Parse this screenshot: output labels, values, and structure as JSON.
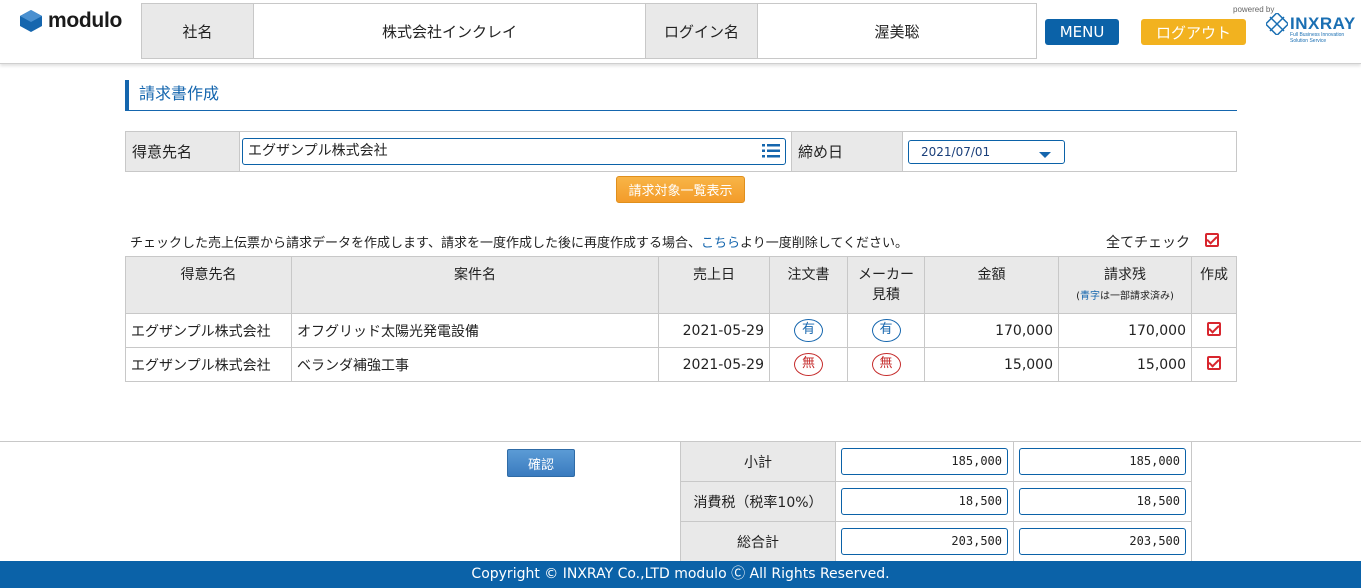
{
  "header": {
    "logo_text": "modulo",
    "company_label": "社名",
    "company_value": "株式会社インクレイ",
    "login_label": "ログイン名",
    "login_value": "渥美聡",
    "menu_label": "MENU",
    "logout_label": "ログアウト",
    "powered_by": "powered by",
    "brand_name": "INXRAY",
    "brand_tagline": "Full Business Innovation Solution Service",
    "menu_color": "#0b62a8",
    "logout_color": "#f2b21f"
  },
  "page": {
    "title": "請求書作成"
  },
  "search": {
    "customer_label": "得意先名",
    "customer_value": "エグザンプル株式会社",
    "closing_label": "締め日",
    "closing_value": "2021/07/01",
    "list_button": "請求対象一覧表示"
  },
  "note": {
    "text_before": "チェックした売上伝票から請求データを作成します、請求を一度作成した後に再度作成する場合、",
    "link": "こちら",
    "text_after": "より一度削除してください。",
    "check_all": "全てチェック"
  },
  "table": {
    "headers": {
      "customer": "得意先名",
      "project": "案件名",
      "sales_date": "売上日",
      "order": "注文書",
      "maker": "メーカー",
      "maker2": "見積",
      "amount": "金額",
      "remaining": "請求残",
      "remaining_note_blue": "青字",
      "remaining_note_rest": "は一部請求済み)",
      "remaining_note_open": "(",
      "create": "作成"
    },
    "rows": [
      {
        "customer": "エグザンプル株式会社",
        "project": "オフグリッド太陽光発電設備",
        "date": "2021-05-29",
        "order": "有",
        "maker": "有",
        "amount": "170,000",
        "remaining": "170,000",
        "checked": true
      },
      {
        "customer": "エグザンプル株式会社",
        "project": "ベランダ補強工事",
        "date": "2021-05-29",
        "order": "無",
        "maker": "無",
        "amount": "15,000",
        "remaining": "15,000",
        "checked": true
      }
    ]
  },
  "footer": {
    "confirm_button": "確認",
    "subtotal_label": "小計",
    "subtotal_a": "185,000",
    "subtotal_b": "185,000",
    "tax_label": "消費税（税率10%）",
    "tax_a": "18,500",
    "tax_b": "18,500",
    "total_label": "総合計",
    "total_a": "203,500",
    "total_b": "203,500",
    "copyright": "Copyright © INXRAY Co.,LTD modulo Ⓒ All Rights Reserved."
  }
}
